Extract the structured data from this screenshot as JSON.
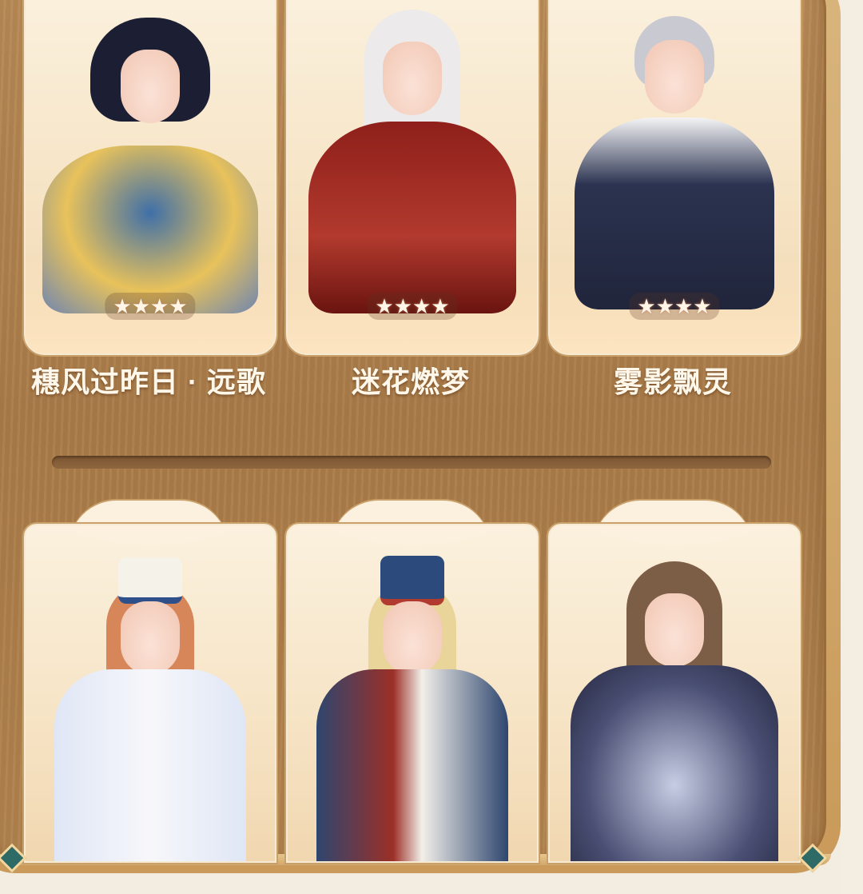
{
  "outfits_top": [
    {
      "name": "穗风过昨日 · 远歌",
      "stars": "★★★★",
      "star_count": 4
    },
    {
      "name": "迷花燃梦",
      "stars": "★★★★",
      "star_count": 4
    },
    {
      "name": "雾影飘灵",
      "stars": "★★★★",
      "star_count": 4
    }
  ],
  "outfits_bottom": [
    {
      "id": "outfit-white-uniform"
    },
    {
      "id": "outfit-blue-uniform"
    },
    {
      "id": "outfit-lace-gown"
    }
  ],
  "colors": {
    "board": "#a97b48",
    "card": "#fbf1de",
    "name_text": "#fff8ea",
    "gem": "#2f6b66"
  }
}
